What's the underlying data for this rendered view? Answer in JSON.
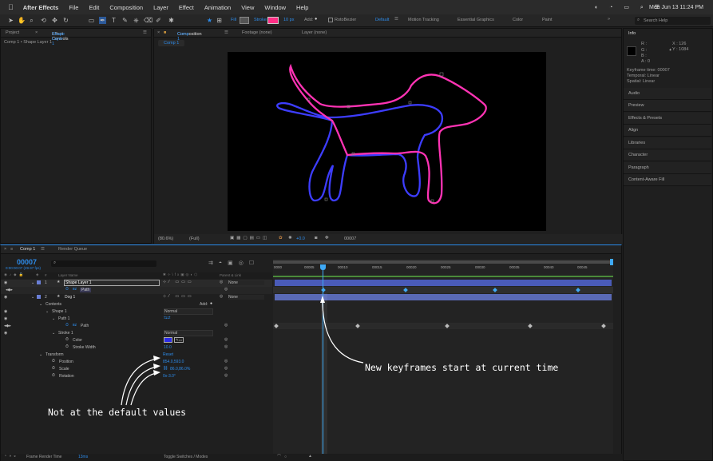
{
  "menubar": {
    "app_name": "After Effects",
    "items": [
      "File",
      "Edit",
      "Composition",
      "Layer",
      "Effect",
      "Animation",
      "View",
      "Window",
      "Help"
    ],
    "clock": "Mon Jun 13  11:24 PM"
  },
  "toolbar": {
    "fill_label": "Fill",
    "stroke_label": "Stroke",
    "stroke_width": "10 px",
    "add_label": "Add:",
    "rotobezier_label": "RotoBezier",
    "workspaces": [
      "Default",
      "Motion Tracking",
      "Essential Graphics",
      "Color",
      "Paint"
    ],
    "search_placeholder": "Search Help"
  },
  "left_panel": {
    "tab_project": "Project",
    "tab_effect_controls": "Effect Controls",
    "tab_effect_target": "Shape Layer 1",
    "subtitle": "Comp 1 • Shape Layer 1"
  },
  "viewer": {
    "tab_prefix": "Composition",
    "tab_comp": "Comp 1",
    "tab_footage": "Footage (none)",
    "tab_layer": "Layer (none)",
    "comp_button": "Comp 1",
    "zoom": "(80.6%)",
    "resolution": "(Full)",
    "exposure": "+0.0",
    "timecode": "00007"
  },
  "info_panel": {
    "title": "Info",
    "r": "R :",
    "g": "G :",
    "b": "B :",
    "a": "A :  0",
    "x": "X : 126",
    "y": "Y : 1084",
    "keyframe_time": "Keyframe time: 00007",
    "temporal": "Temporal: Linear",
    "spatial": "Spatial: Linear"
  },
  "right_panels": [
    "Audio",
    "Preview",
    "Effects & Presets",
    "Align",
    "Libraries",
    "Character",
    "Paragraph",
    "Content-Aware Fill"
  ],
  "timeline": {
    "tab_comp": "Comp 1",
    "tab_render": "Render Queue",
    "current_time": "00007",
    "time_sub": "0:00:00:07 (29.97 fps)",
    "col_layer_name": "Layer Name",
    "col_parent": "Parent & Link",
    "ruler_ticks": [
      "0000",
      "00005",
      "00010",
      "00015",
      "00020",
      "00025",
      "00030",
      "00035",
      "00040",
      "00045"
    ],
    "rows": [
      {
        "num": "1",
        "name": "Shape Layer 1",
        "parent": "None"
      },
      {
        "num": "",
        "name": "Path",
        "parent": ""
      },
      {
        "num": "2",
        "name": "Dog 1",
        "parent": "None"
      },
      {
        "num": "",
        "name": "Contents",
        "parent": ""
      },
      {
        "num": "",
        "name": "Shape 1",
        "parent": "Normal"
      },
      {
        "num": "",
        "name": "Path 1",
        "parent": ""
      },
      {
        "num": "",
        "name": "Path",
        "parent": ""
      },
      {
        "num": "",
        "name": "Stroke 1",
        "parent": "Normal"
      },
      {
        "num": "",
        "name": "Color",
        "parent": ""
      },
      {
        "num": "",
        "name": "Stroke Width",
        "parent": ""
      },
      {
        "num": "",
        "name": "Transform",
        "parent": ""
      },
      {
        "num": "",
        "name": "Position",
        "parent": ""
      },
      {
        "num": "",
        "name": "Scale",
        "parent": ""
      },
      {
        "num": "",
        "name": "Rotation",
        "parent": ""
      }
    ],
    "add_label": "Add:",
    "stroke_width_value": "10.0",
    "reset_label": "Reset",
    "position_value": "854.0,593.0",
    "scale_value": "86.0,86.0%",
    "rotation_value": "0x-3.0°",
    "footer_render": "Frame Render Time",
    "footer_ms": "13ms",
    "footer_toggle": "Toggle Switches / Modes"
  },
  "annotations": {
    "keyframes_note": "New keyframes start at current time",
    "default_note": "Not at the default values"
  },
  "colors": {
    "accent_blue": "#2d8ceb",
    "layer1_bar": "#4a5bb8",
    "layer2_bar": "#5a6ab6",
    "pink_stroke": "#ff33b4",
    "blue_stroke": "#3d3dff",
    "work_area_green": "#4a8a3a"
  }
}
